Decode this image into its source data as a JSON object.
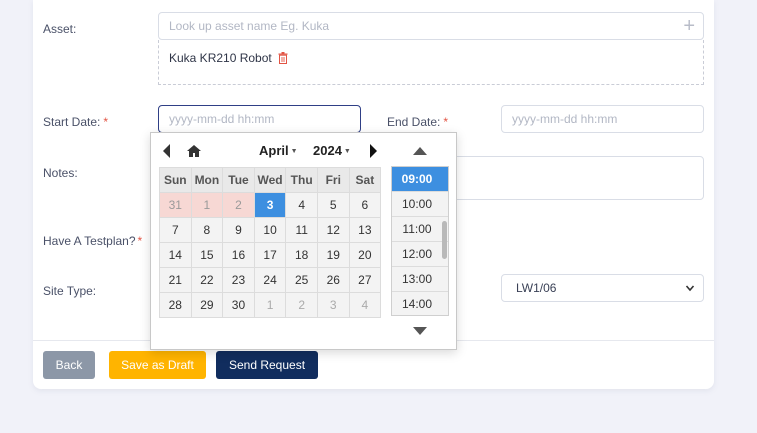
{
  "form": {
    "asset_label": "Asset:",
    "asset_placeholder": "Look up asset name Eg. Kuka",
    "asset_selected": "Kuka KR210 Robot",
    "start_date_label": "Start Date:",
    "start_date_placeholder": "yyyy-mm-dd hh:mm",
    "end_date_label": "End Date:",
    "end_date_placeholder": "yyyy-mm-dd hh:mm",
    "notes_label": "Notes:",
    "testplan_label": "Have A Testplan?",
    "site_type_label": "Site Type:",
    "site_value": "LW1/06",
    "required_mark": "*"
  },
  "buttons": {
    "back": "Back",
    "draft": "Save as Draft",
    "send": "Send Request"
  },
  "picker": {
    "month": "April",
    "year": "2024",
    "weekdays": [
      "Sun",
      "Mon",
      "Tue",
      "Wed",
      "Thu",
      "Fri",
      "Sat"
    ],
    "weeks": [
      [
        [
          "31",
          "prev"
        ],
        [
          "1",
          "prev"
        ],
        [
          "2",
          "prev"
        ],
        [
          "3",
          "today"
        ],
        [
          "4",
          ""
        ],
        [
          "5",
          ""
        ],
        [
          "6",
          ""
        ]
      ],
      [
        [
          "7",
          ""
        ],
        [
          "8",
          ""
        ],
        [
          "9",
          ""
        ],
        [
          "10",
          ""
        ],
        [
          "11",
          ""
        ],
        [
          "12",
          ""
        ],
        [
          "13",
          ""
        ]
      ],
      [
        [
          "14",
          ""
        ],
        [
          "15",
          ""
        ],
        [
          "16",
          ""
        ],
        [
          "17",
          ""
        ],
        [
          "18",
          ""
        ],
        [
          "19",
          ""
        ],
        [
          "20",
          ""
        ]
      ],
      [
        [
          "21",
          ""
        ],
        [
          "22",
          ""
        ],
        [
          "23",
          ""
        ],
        [
          "24",
          ""
        ],
        [
          "25",
          ""
        ],
        [
          "26",
          ""
        ],
        [
          "27",
          ""
        ]
      ],
      [
        [
          "28",
          ""
        ],
        [
          "29",
          ""
        ],
        [
          "30",
          ""
        ],
        [
          "1",
          "next"
        ],
        [
          "2",
          "next"
        ],
        [
          "3",
          "next"
        ],
        [
          "4",
          "next"
        ]
      ]
    ],
    "times": [
      "09:00",
      "10:00",
      "11:00",
      "12:00",
      "13:00",
      "14:00"
    ],
    "selected_time": "09:00"
  },
  "colors": {
    "accent_blue": "#3d8fe0",
    "required": "#e25444",
    "send_button": "#112d5e",
    "draft_button": "#ffb400",
    "back_button": "#8c97a7"
  }
}
